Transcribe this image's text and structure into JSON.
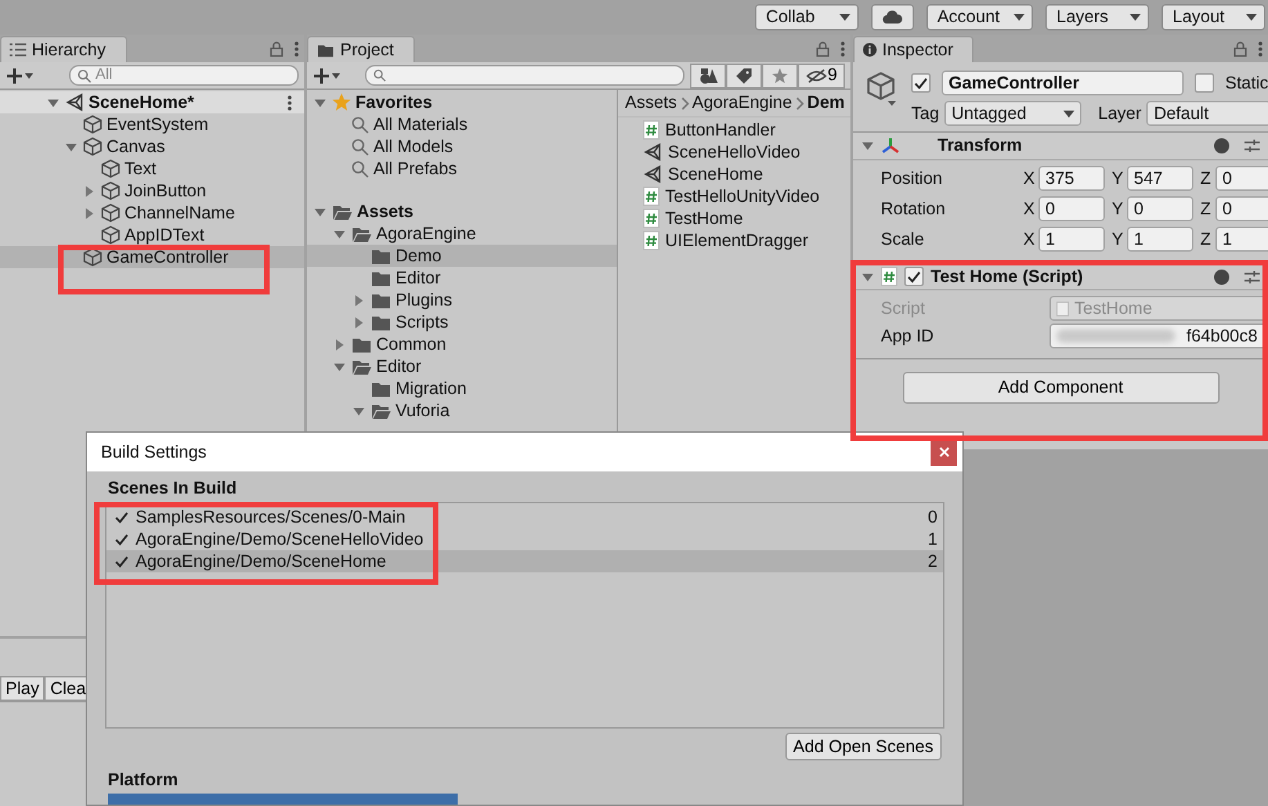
{
  "toolbar": [
    {
      "kind": "dropdown",
      "label": "Collab"
    },
    {
      "kind": "cloud"
    },
    {
      "kind": "dropdown",
      "label": "Account"
    },
    {
      "kind": "dropdown",
      "label": "Layers"
    },
    {
      "kind": "dropdown",
      "label": "Layout"
    }
  ],
  "hierarchy": {
    "title": "Hierarchy",
    "search_placeholder": "All",
    "items": [
      {
        "label": "SceneHome*",
        "kind": "scene",
        "expanded": true,
        "selected": false,
        "children": [
          {
            "label": "EventSystem",
            "kind": "object",
            "selected": false
          },
          {
            "label": "Canvas",
            "kind": "object",
            "expanded": true,
            "selected": false,
            "children": [
              {
                "label": "Text",
                "kind": "object",
                "selected": false
              },
              {
                "label": "JoinButton",
                "kind": "object",
                "expanded": false,
                "selected": false
              },
              {
                "label": "ChannelName",
                "kind": "object",
                "expanded": false,
                "selected": false
              },
              {
                "label": "AppIDText",
                "kind": "object",
                "selected": false
              }
            ]
          },
          {
            "label": "GameController",
            "kind": "object",
            "selected": true
          }
        ]
      }
    ]
  },
  "console": {
    "buttons": [
      "Play",
      "Clea"
    ]
  },
  "project": {
    "title": "Project",
    "hidden_count": "9",
    "tree": [
      {
        "label": "Favorites",
        "kind": "favorites",
        "expanded": true,
        "selected": false,
        "children": [
          {
            "label": "All Materials",
            "kind": "search",
            "selected": false
          },
          {
            "label": "All Models",
            "kind": "search",
            "selected": false
          },
          {
            "label": "All Prefabs",
            "kind": "search",
            "selected": false
          }
        ]
      },
      {
        "label": "Assets",
        "kind": "root",
        "expanded": true,
        "selected": false,
        "children": [
          {
            "label": "AgoraEngine",
            "kind": "folder",
            "expanded": true,
            "selected": false,
            "children": [
              {
                "label": "Demo",
                "kind": "folder",
                "selected": true
              },
              {
                "label": "Editor",
                "kind": "folder",
                "selected": false
              },
              {
                "label": "Plugins",
                "kind": "folder",
                "expanded": false,
                "selected": false
              },
              {
                "label": "Scripts",
                "kind": "folder",
                "expanded": false,
                "selected": false
              }
            ]
          },
          {
            "label": "Common",
            "kind": "folder",
            "expanded": false,
            "selected": false
          },
          {
            "label": "Editor",
            "kind": "folder",
            "expanded": true,
            "selected": false,
            "children": [
              {
                "label": "Migration",
                "kind": "folder",
                "selected": false
              },
              {
                "label": "Vuforia",
                "kind": "folder",
                "expanded": true,
                "selected": false
              }
            ]
          }
        ]
      }
    ],
    "breadcrumb": [
      "Assets",
      "AgoraEngine",
      "Dem"
    ],
    "files": [
      {
        "label": "ButtonHandler",
        "kind": "script"
      },
      {
        "label": "SceneHelloVideo",
        "kind": "scene"
      },
      {
        "label": "SceneHome",
        "kind": "scene"
      },
      {
        "label": "TestHelloUnityVideo",
        "kind": "script"
      },
      {
        "label": "TestHome",
        "kind": "script"
      },
      {
        "label": "UIElementDragger",
        "kind": "script"
      }
    ]
  },
  "inspector": {
    "title": "Inspector",
    "object": {
      "name": "GameController",
      "active": true,
      "static": false,
      "static_label": "Static",
      "tag_label": "Tag",
      "tag": "Untagged",
      "layer_label": "Layer",
      "layer": "Default"
    },
    "components": [
      {
        "kind": "transform",
        "title": "Transform",
        "expanded": true,
        "rows": [
          {
            "label": "Position",
            "values": [
              {
                "axis": "X",
                "value": "375"
              },
              {
                "axis": "Y",
                "value": "547"
              },
              {
                "axis": "Z",
                "value": "0"
              }
            ]
          },
          {
            "label": "Rotation",
            "values": [
              {
                "axis": "X",
                "value": "0"
              },
              {
                "axis": "Y",
                "value": "0"
              },
              {
                "axis": "Z",
                "value": "0"
              }
            ]
          },
          {
            "label": "Scale",
            "values": [
              {
                "axis": "X",
                "value": "1"
              },
              {
                "axis": "Y",
                "value": "1"
              },
              {
                "axis": "Z",
                "value": "1"
              }
            ]
          }
        ]
      },
      {
        "kind": "script",
        "title": "Test Home (Script)",
        "expanded": true,
        "enabled": true,
        "fields": [
          {
            "label": "Script",
            "kind": "object",
            "value": "TestHome",
            "disabled": true
          },
          {
            "label": "App ID",
            "kind": "redacted",
            "value": "f64b00c8",
            "disabled": false
          }
        ]
      }
    ],
    "add_component": "Add Component"
  },
  "build_settings": {
    "title": "Build Settings",
    "section": "Scenes In Build",
    "scenes": [
      {
        "path": "SamplesResources/Scenes/0-Main",
        "index": "0",
        "checked": true,
        "selected": false
      },
      {
        "path": "AgoraEngine/Demo/SceneHelloVideo",
        "index": "1",
        "checked": true,
        "selected": false
      },
      {
        "path": "AgoraEngine/Demo/SceneHome",
        "index": "2",
        "checked": true,
        "selected": true
      }
    ],
    "add_open_scenes": "Add Open Scenes",
    "platform_label": "Platform"
  }
}
